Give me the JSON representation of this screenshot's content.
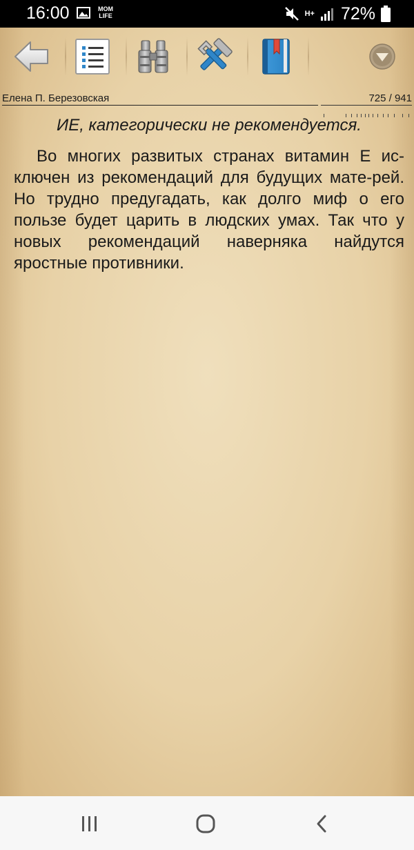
{
  "status_bar": {
    "time": "16:00",
    "app_badge": "MOM\nLIFE",
    "network": "H+",
    "battery": "72%"
  },
  "toolbar": {
    "buttons": [
      {
        "icon": "back-arrow-icon"
      },
      {
        "icon": "table-of-contents-icon"
      },
      {
        "icon": "binoculars-search-icon"
      },
      {
        "icon": "tools-settings-icon"
      },
      {
        "icon": "bookmark-book-icon"
      },
      {
        "icon": "dropdown-menu-icon"
      }
    ]
  },
  "header": {
    "author": "Елена П. Березовская",
    "page_indicator": "725 / 941"
  },
  "content": {
    "italic_line": "ИЕ, категорически не рекомендуется.",
    "paragraph": "Во многих развитых странах витамин Е ис-ключен из рекомендаций для будущих мате-рей. Но трудно предугадать, как долго миф о его пользе будет царить в людских умах. Так что у новых рекомендаций наверняка найдутся яростные противники."
  },
  "colors": {
    "parchment": "#e8d3ab",
    "text": "#1a1a1a",
    "accent_blue": "#2f86c9"
  }
}
